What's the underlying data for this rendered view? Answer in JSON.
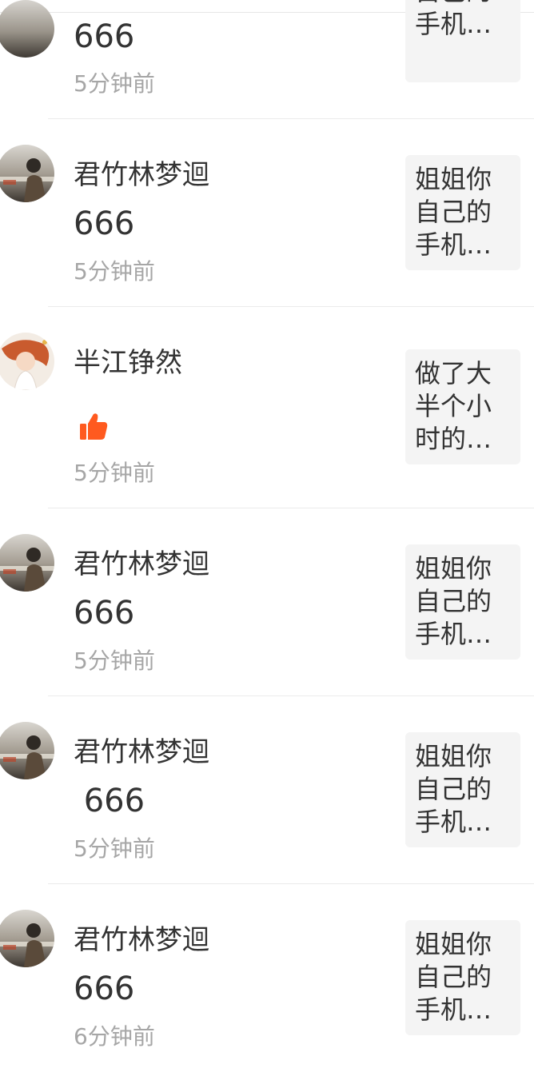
{
  "colors": {
    "like": "#ff5a1f",
    "text": "#333333",
    "muted": "#a6a6a6",
    "preview_bg": "#f4f4f4"
  },
  "items": [
    {
      "name": "",
      "content": "666",
      "time": "5分钟前",
      "preview": [
        "",
        "自己的",
        "手机…"
      ],
      "avatar": "boy-avatar"
    },
    {
      "name": "君竹林梦迴",
      "content": "666",
      "time": "5分钟前",
      "preview": [
        "姐姐你",
        "自己的",
        "手机…"
      ],
      "avatar": "boy-avatar"
    },
    {
      "name": "半江铮然",
      "content_icon": "thumbs-up-icon",
      "time": "5分钟前",
      "preview": [
        "做了大",
        "半个小",
        "时的…"
      ],
      "avatar": "girl-avatar"
    },
    {
      "name": "君竹林梦迴",
      "content": "666",
      "time": "5分钟前",
      "preview": [
        "姐姐你",
        "自己的",
        "手机…"
      ],
      "avatar": "boy-avatar"
    },
    {
      "name": "君竹林梦迴",
      "content": " 666",
      "time": "5分钟前",
      "preview": [
        "姐姐你",
        "自己的",
        "手机…"
      ],
      "avatar": "boy-avatar"
    },
    {
      "name": "君竹林梦迴",
      "content": "666",
      "time": "6分钟前",
      "preview": [
        "姐姐你",
        "自己的",
        "手机…"
      ],
      "avatar": "boy-avatar"
    }
  ]
}
